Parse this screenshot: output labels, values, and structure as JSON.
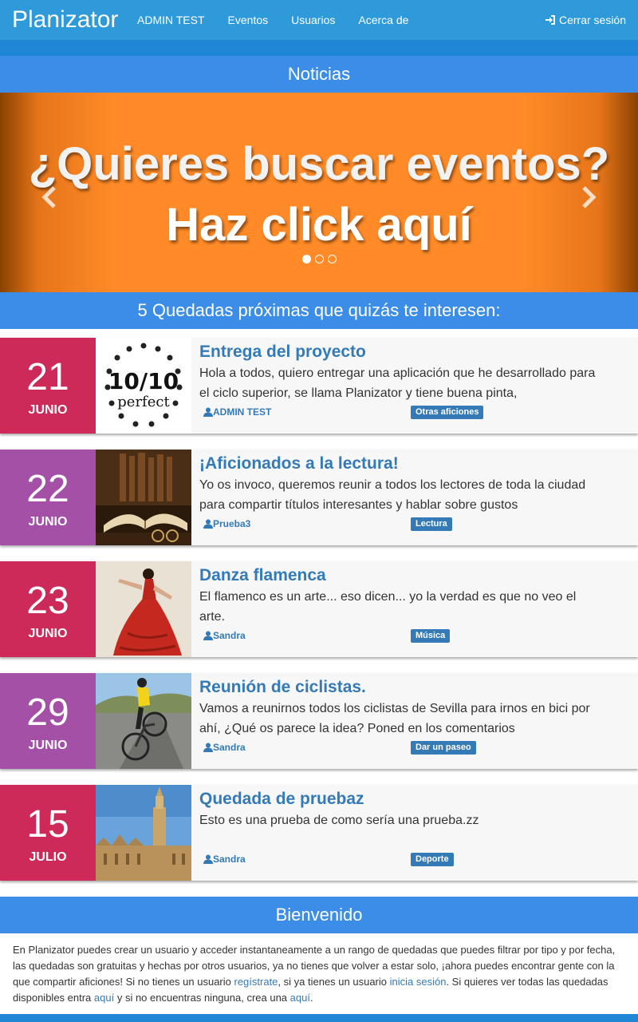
{
  "navbar": {
    "brand": "Planizator",
    "items": [
      "ADMIN TEST",
      "Eventos",
      "Usuarios",
      "Acerca de"
    ],
    "logout": "Cerrar sesión"
  },
  "news": {
    "heading": "Noticias",
    "carousel": {
      "line1": "¿Quieres buscar eventos?",
      "line2": "Haz click aquí",
      "slides": 3,
      "active_slide": 1
    }
  },
  "upcoming": {
    "heading": "5 Quedadas próximas que quizás te interesen:",
    "events": [
      {
        "day": "21",
        "month": "JUNIO",
        "title": "Entrega del proyecto",
        "description": "Hola a todos, quiero entregar una aplicación que he desarrollado para el ciclo superior, se llama Planizator y tiene buena pinta,",
        "user": "ADMIN TEST",
        "category": "Otras aficiones",
        "image": "10-10-perfect-badge",
        "date_color": "#cd2a5a"
      },
      {
        "day": "22",
        "month": "JUNIO",
        "title": "¡Aficionados a la lectura!",
        "description": "Yo os invoco, queremos reunir a todos los lectores de toda la ciudad para compartir títulos interesantes y hablar sobre gustos",
        "user": "Prueba3",
        "category": "Lectura",
        "image": "open-books-photo",
        "date_color": "#a550a7"
      },
      {
        "day": "23",
        "month": "JUNIO",
        "title": "Danza flamenca",
        "description": "El flamenco es un arte... eso dicen... yo la verdad es que no veo el arte.",
        "user": "Sandra",
        "category": "Música",
        "image": "flamenco-dancer-photo",
        "date_color": "#cd2a5a"
      },
      {
        "day": "29",
        "month": "JUNIO",
        "title": "Reunión de ciclistas.",
        "description": "Vamos a reunirnos todos los ciclistas de Sevilla para irnos en bici por ahí, ¿Qué os parece la idea? Poned en los comentarios",
        "user": "Sandra",
        "category": "Dar un paseo",
        "image": "cyclist-photo",
        "date_color": "#a550a7"
      },
      {
        "day": "15",
        "month": "JULIO",
        "title": "Quedada de pruebaz",
        "description": "Esto es una prueba de como sería una prueba.zz",
        "user": "Sandra",
        "category": "Deporte",
        "image": "seville-cathedral-photo",
        "date_color": "#cd2a5a"
      }
    ]
  },
  "welcome": {
    "heading": "Bienvenido",
    "text_1": "En Planizator puedes crear un usuario y acceder instantaneamente a un rango de quedadas que puedes filtrar por tipo y por fecha, las quedadas son gratuitas y hechas por otros usuarios, ya no tienes que volver a estar solo, ¡ahora puedes encontrar gente con la que compartir aficiones! Si no tienes un usuario ",
    "link_register": "regístrate",
    "text_2": ", si ya tienes un usuario ",
    "link_login": "inicia sesión",
    "text_3": ". Si quieres ver todas las quedadas disponibles entra ",
    "link_all": "aquí",
    "text_4": " y si no encuentras ninguna, crea una ",
    "link_create": "aquí",
    "text_5": "."
  },
  "colors": {
    "navbar": "#2e9ad9",
    "section_heading": "#3b8de8",
    "date_crimson": "#cd2a5a",
    "date_purple": "#a550a7",
    "link": "#337ab7",
    "carousel": "#ff8a27"
  }
}
